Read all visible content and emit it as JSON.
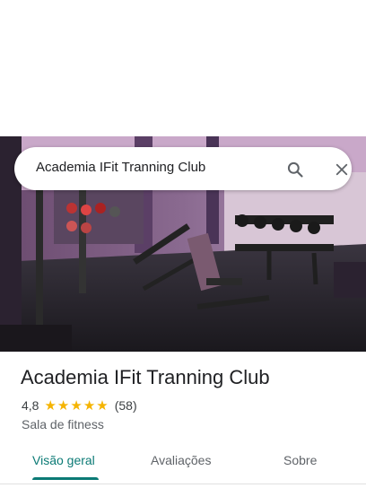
{
  "search": {
    "query": "Academia IFit Tranning Club"
  },
  "place": {
    "name": "Academia IFit Tranning Club",
    "rating": "4,8",
    "stars": 5,
    "review_count": "(58)",
    "category": "Sala de fitness"
  },
  "tabs": [
    {
      "label": "Visão geral",
      "active": true
    },
    {
      "label": "Avaliações",
      "active": false
    },
    {
      "label": "Sobre",
      "active": false
    }
  ],
  "colors": {
    "active_tab": "#0b7a75",
    "star": "#f5b400"
  }
}
